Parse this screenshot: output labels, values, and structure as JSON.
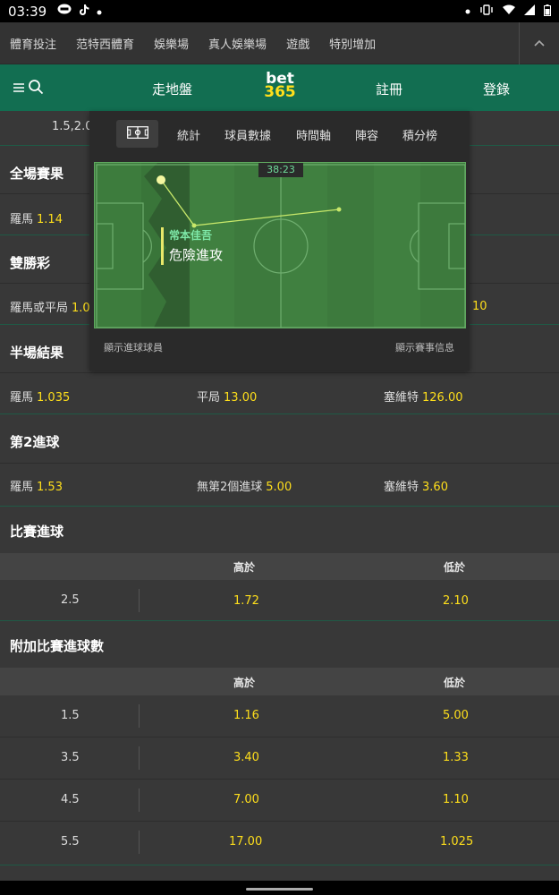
{
  "status_bar": {
    "time": "03:39"
  },
  "nav_top": {
    "items": [
      "體育投注",
      "范特西體育",
      "娛樂場",
      "真人娛樂場",
      "遊戲",
      "特別增加"
    ]
  },
  "nav_main": {
    "live": "走地盤",
    "register": "註冊",
    "login": "登錄",
    "logo_top": "bet",
    "logo_bottom": "365"
  },
  "partial_row": {
    "text": "1.5,2.0"
  },
  "overlay": {
    "tabs": [
      "統計",
      "球員數據",
      "時間軸",
      "陣容",
      "積分榜"
    ],
    "match_time": "38:23",
    "event_player": "常本佳吾",
    "event_text": "危險進攻",
    "show_scorers": "顯示進球球員",
    "match_info": "顯示賽事信息"
  },
  "full_time_result": {
    "title": "全場賽果",
    "home_label": "羅馬",
    "home_odds": "1.14"
  },
  "double_chance": {
    "title": "雙勝彩",
    "home_draw_label": "羅馬或平局",
    "home_draw_odds": "1.0",
    "right_odds": "10"
  },
  "half_time_result": {
    "title": "半場結果",
    "home_label": "羅馬",
    "home_odds": "1.035",
    "draw_label": "平局",
    "draw_odds": "13.00",
    "away_label": "塞維特",
    "away_odds": "126.00"
  },
  "second_goal": {
    "title": "第2進球",
    "home_label": "羅馬",
    "home_odds": "1.53",
    "none_label": "無第2個進球",
    "none_odds": "5.00",
    "away_label": "塞維特",
    "away_odds": "3.60"
  },
  "match_goals": {
    "title": "比賽進球",
    "over_label": "高於",
    "under_label": "低於",
    "rows": [
      {
        "line": "2.5",
        "over": "1.72",
        "under": "2.10"
      }
    ]
  },
  "alt_goals": {
    "title": "附加比賽進球數",
    "over_label": "高於",
    "under_label": "低於",
    "rows": [
      {
        "line": "1.5",
        "over": "1.16",
        "under": "5.00"
      },
      {
        "line": "3.5",
        "over": "3.40",
        "under": "1.33"
      },
      {
        "line": "4.5",
        "over": "7.00",
        "under": "1.10"
      },
      {
        "line": "5.5",
        "over": "17.00",
        "under": "1.025"
      }
    ]
  }
}
